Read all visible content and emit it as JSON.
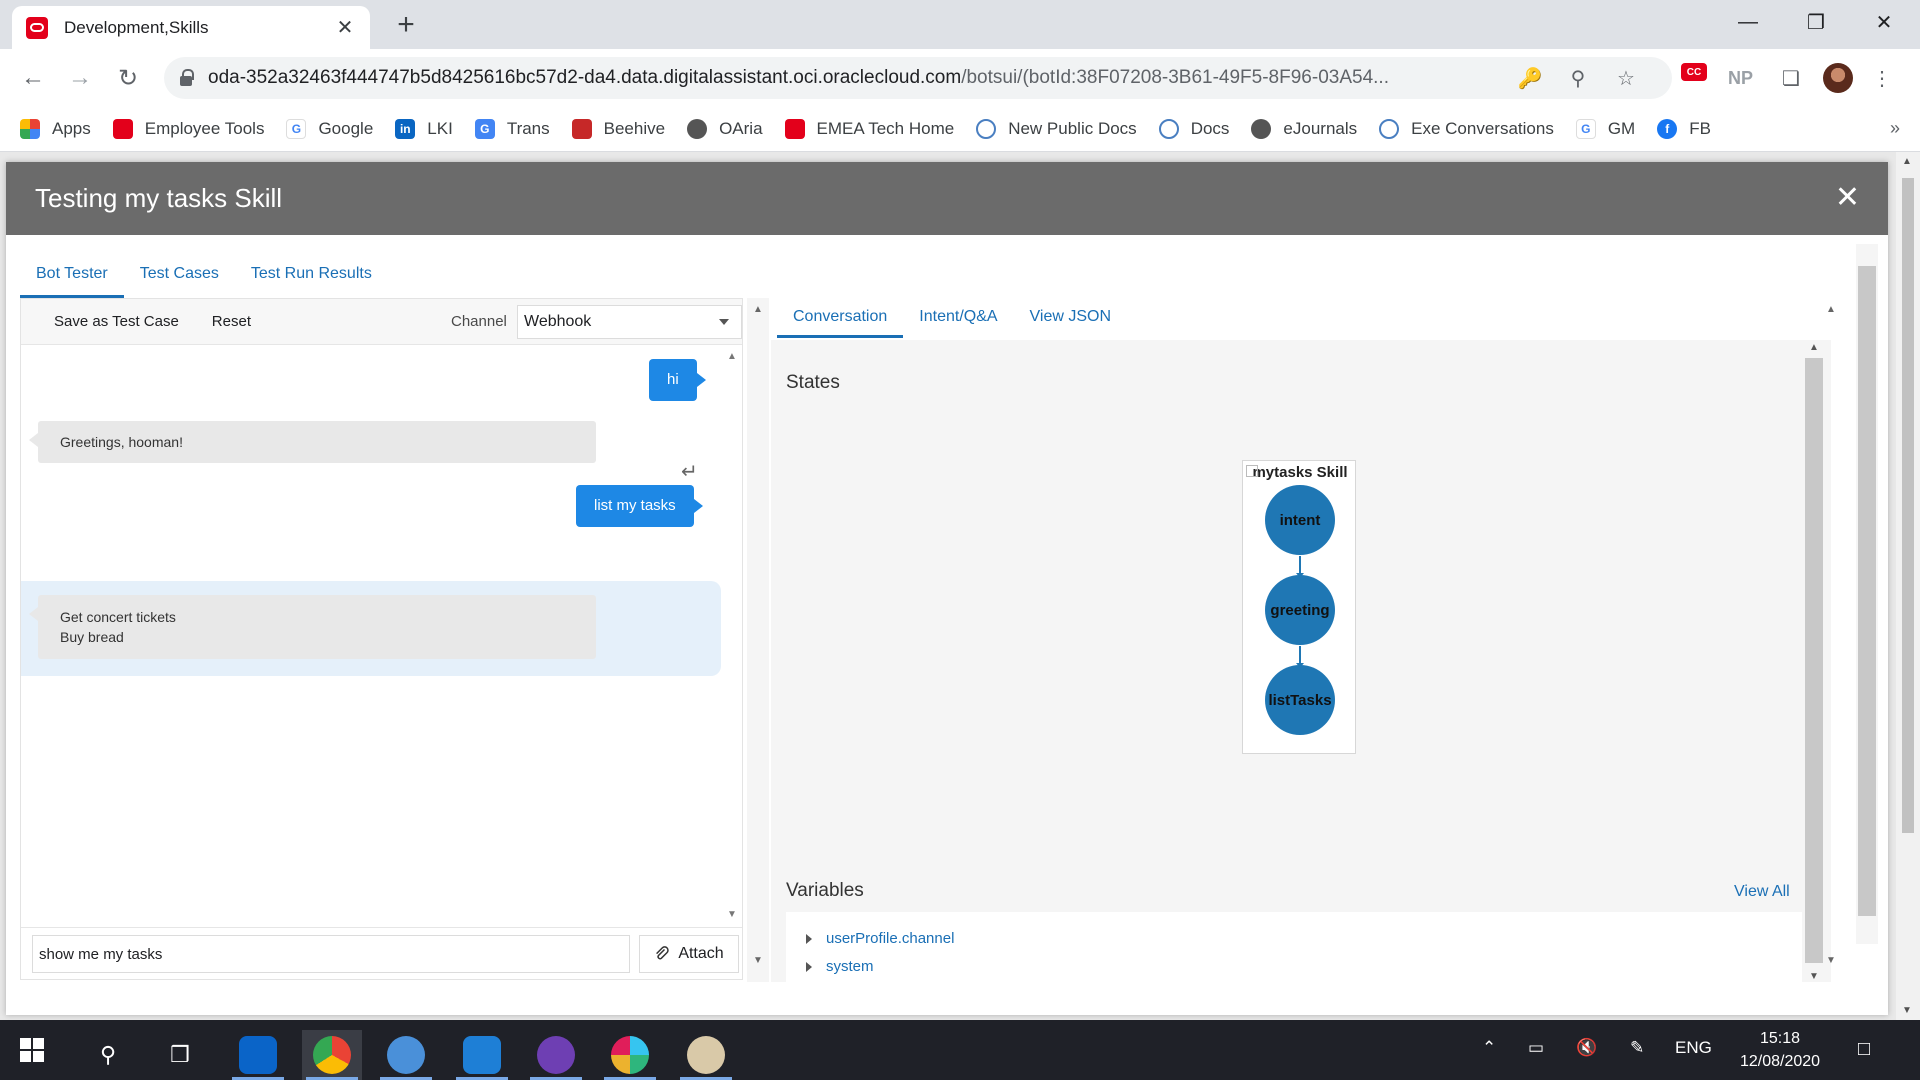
{
  "browser": {
    "tab_title": "Development,Skills",
    "url_main": "oda-352a32463f444747b5d8425616bc57d2-da4.data.digitalassistant.oci.oraclecloud.com",
    "url_rest": "/botsui/(botId:38F07208-3B61-49F5-8F96-03A54...",
    "ext_cc": "CC",
    "ext_np": "NP"
  },
  "bookmarks": [
    {
      "label": "Apps",
      "icon": "apps-grid-icon"
    },
    {
      "label": "Employee Tools",
      "icon": "oracle-icon"
    },
    {
      "label": "Google",
      "icon": "google-icon"
    },
    {
      "label": "LKI",
      "icon": "linkedin-icon"
    },
    {
      "label": "Trans",
      "icon": "translate-icon"
    },
    {
      "label": "Beehive",
      "icon": "beehive-icon"
    },
    {
      "label": "OAria",
      "icon": "globe-icon"
    },
    {
      "label": "EMEA Tech Home",
      "icon": "oracle-icon"
    },
    {
      "label": "New Public Docs",
      "icon": "cloud-icon"
    },
    {
      "label": "Docs",
      "icon": "cloud-icon"
    },
    {
      "label": "eJournals",
      "icon": "globe-icon"
    },
    {
      "label": "Exe Conversations",
      "icon": "cloud-icon"
    },
    {
      "label": "GM",
      "icon": "google-icon"
    },
    {
      "label": "FB",
      "icon": "facebook-icon"
    }
  ],
  "modal": {
    "title": "Testing my tasks Skill",
    "tabs": [
      "Bot Tester",
      "Test Cases",
      "Test Run Results"
    ]
  },
  "left": {
    "save_label": "Save as Test Case",
    "reset_label": "Reset",
    "channel_label": "Channel",
    "channel_value": "Webhook",
    "messages": {
      "user1": "hi",
      "bot1": "Greetings, hooman!",
      "user2": "list my tasks",
      "bot2_line1": "Get concert tickets",
      "bot2_line2": "Buy bread"
    },
    "input_value": "show me my tasks",
    "attach_label": "Attach"
  },
  "right": {
    "tabs": [
      "Conversation",
      "Intent/Q&A",
      "View JSON"
    ],
    "states_label": "States",
    "graph_title": "mytasks Skill",
    "nodes": [
      "intent",
      "greeting",
      "listTasks"
    ],
    "variables_label": "Variables",
    "view_all": "View All",
    "variables": [
      "userProfile.channel",
      "system"
    ]
  },
  "taskbar": {
    "language": "ENG",
    "time": "15:18",
    "date": "12/08/2020"
  },
  "colors": {
    "accent": "#1a6fb5",
    "user_bubble": "#1e88e5",
    "node": "#1f77b4",
    "modal_header": "#6b6b6b"
  }
}
